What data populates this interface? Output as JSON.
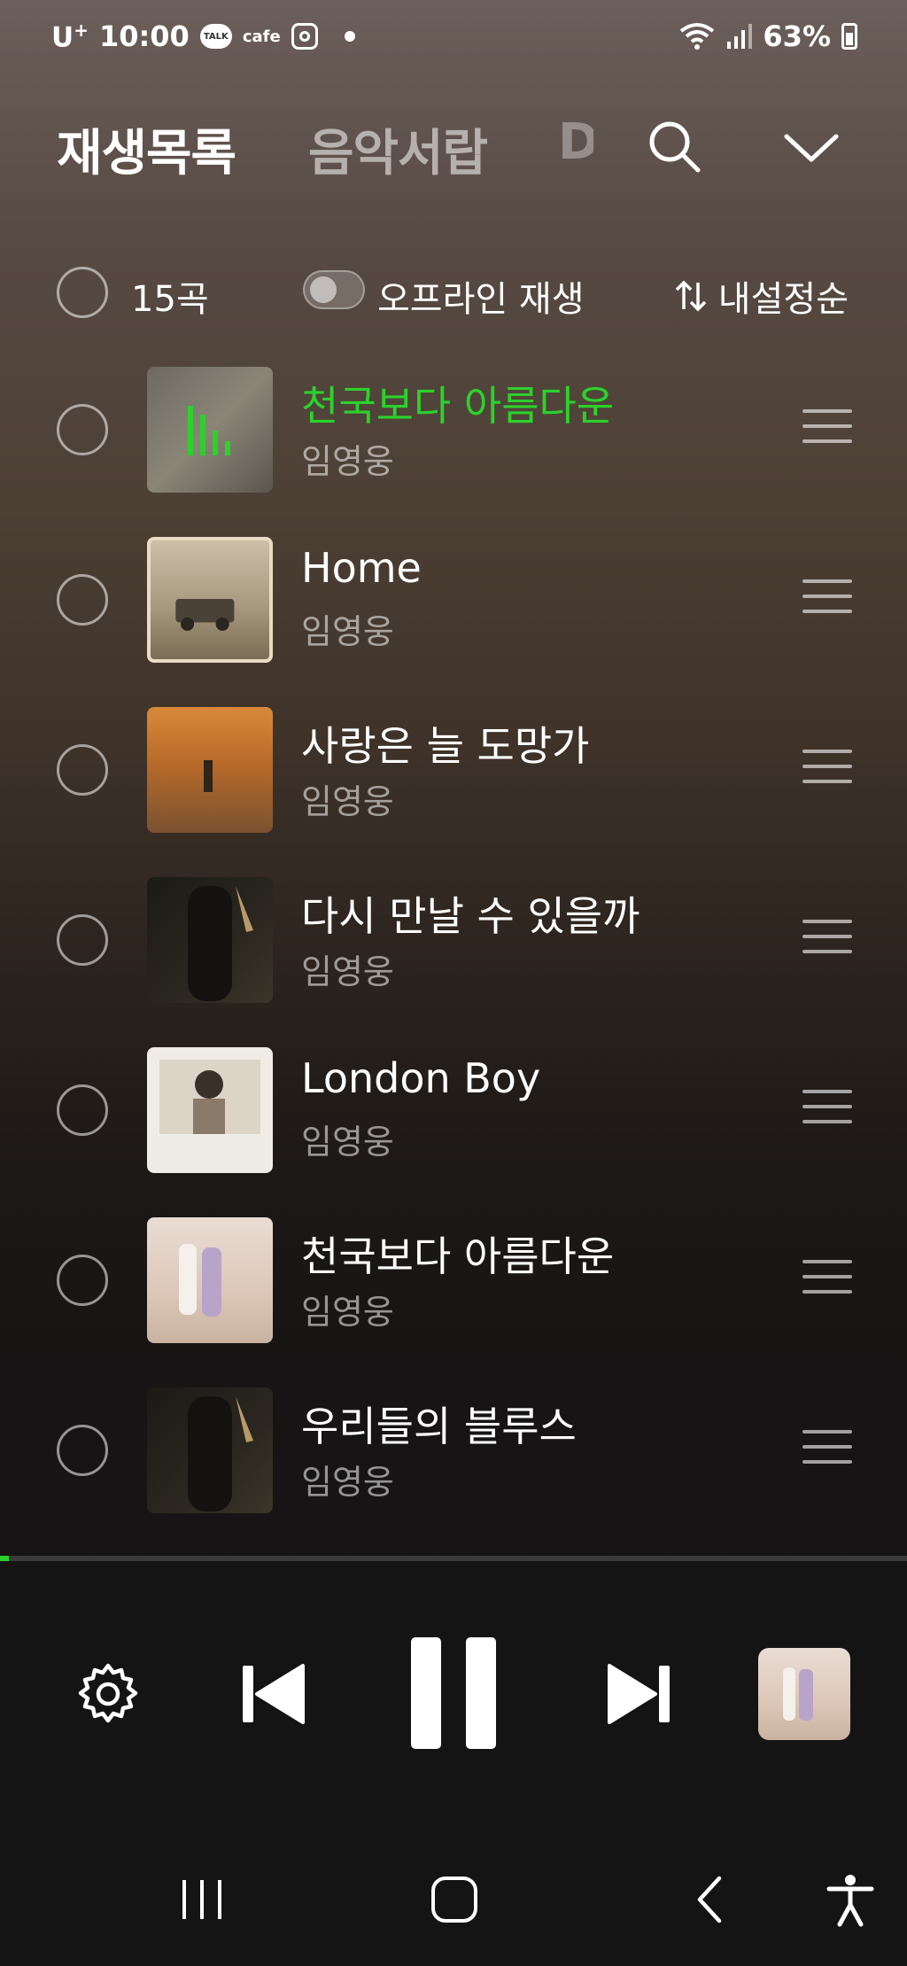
{
  "status_bar": {
    "carrier": "U",
    "carrier_sup": "+",
    "time": "10:00",
    "talk_badge": "TALK",
    "cafe_label": "cafe",
    "battery": "63%"
  },
  "header": {
    "tabs": [
      {
        "label": "재생목록",
        "active": true
      },
      {
        "label": "음악서랍",
        "active": false
      },
      {
        "label": "D",
        "active": false
      }
    ]
  },
  "toolbar": {
    "count": "15곡",
    "offline_label": "오프라인 재생",
    "offline_enabled": false,
    "sort_label": "내설정순"
  },
  "tracks": [
    {
      "title": "천국보다 아름다운",
      "artist": "임영웅",
      "playing": true
    },
    {
      "title": "Home",
      "artist": "임영웅",
      "playing": false
    },
    {
      "title": "사랑은 늘 도망가",
      "artist": "임영웅",
      "playing": false
    },
    {
      "title": "다시 만날 수 있을까",
      "artist": "임영웅",
      "playing": false
    },
    {
      "title": "London Boy",
      "artist": "임영웅",
      "playing": false
    },
    {
      "title": "천국보다 아름다운",
      "artist": "임영웅",
      "playing": false
    },
    {
      "title": "우리들의 블루스",
      "artist": "임영웅",
      "playing": false
    }
  ],
  "player": {
    "progress_fraction": 0.01
  },
  "colors": {
    "accent": "#2bd22b",
    "player_bg": "#141414"
  }
}
